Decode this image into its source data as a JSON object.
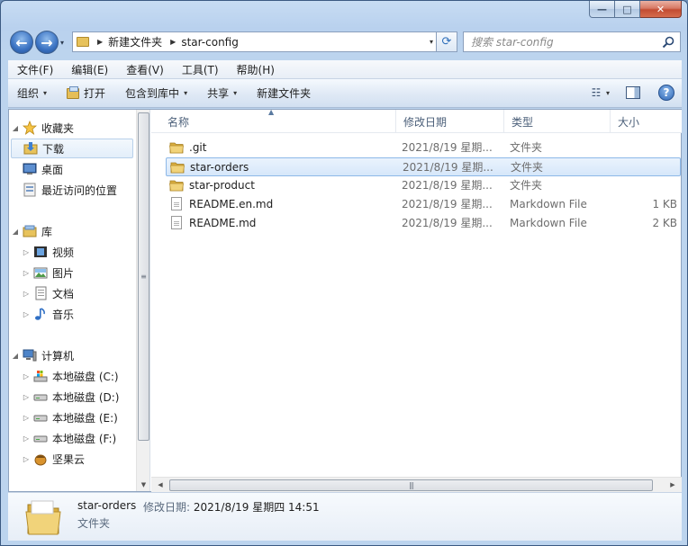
{
  "window": {
    "caption_min": "—",
    "caption_max": "□",
    "caption_close": "✕"
  },
  "nav": {
    "back_arrow": "←",
    "forward_arrow": "→",
    "dropdown": "▾"
  },
  "address": {
    "sep": "▶",
    "segments": [
      "新建文件夹",
      "star-config"
    ],
    "dropdown": "▾",
    "refresh": "⟳"
  },
  "search": {
    "placeholder": "搜索 star-config"
  },
  "menu": {
    "items": [
      "文件(F)",
      "编辑(E)",
      "查看(V)",
      "工具(T)",
      "帮助(H)"
    ]
  },
  "commands": {
    "organize": "组织",
    "open": "打开",
    "include_in_library": "包含到库中",
    "share": "共享",
    "new_folder": "新建文件夹",
    "dropdown": "▾",
    "views_icon": "☷",
    "help": "?"
  },
  "sidebar": {
    "favorites": {
      "label": "收藏夹",
      "items": [
        "下载",
        "桌面",
        "最近访问的位置"
      ]
    },
    "libraries": {
      "label": "库",
      "items": [
        "视频",
        "图片",
        "文档",
        "音乐"
      ]
    },
    "computer": {
      "label": "计算机",
      "items": [
        "本地磁盘 (C:)",
        "本地磁盘 (D:)",
        "本地磁盘 (E:)",
        "本地磁盘 (F:)",
        "坚果云"
      ]
    },
    "expanded_glyph": "◢",
    "collapsed_glyph": "▷",
    "scroll_up": "▲",
    "scroll_down": "▼",
    "grip": "≡"
  },
  "filelist": {
    "columns": [
      "名称",
      "修改日期",
      "类型",
      "大小"
    ],
    "sort_glyph": "▲",
    "rows": [
      {
        "name": ".git",
        "date": "2021/8/19 星期...",
        "type": "文件夹",
        "size": "",
        "kind": "folder"
      },
      {
        "name": "star-orders",
        "date": "2021/8/19 星期...",
        "type": "文件夹",
        "size": "",
        "kind": "folder"
      },
      {
        "name": "star-product",
        "date": "2021/8/19 星期...",
        "type": "文件夹",
        "size": "",
        "kind": "folder"
      },
      {
        "name": "README.en.md",
        "date": "2021/8/19 星期...",
        "type": "Markdown File",
        "size": "1 KB",
        "kind": "file"
      },
      {
        "name": "README.md",
        "date": "2021/8/19 星期...",
        "type": "Markdown File",
        "size": "2 KB",
        "kind": "file"
      }
    ],
    "selected_index": 1,
    "scroll_left": "◀",
    "scroll_right": "▶",
    "grip": "|||"
  },
  "details": {
    "name": "star-orders",
    "date_label": "修改日期:",
    "date_value": "2021/8/19 星期四 14:51",
    "type": "文件夹"
  },
  "colors": {
    "folder": "#e8c35c",
    "selection_border": "#8db8e8",
    "header_text": "#4c607a"
  }
}
